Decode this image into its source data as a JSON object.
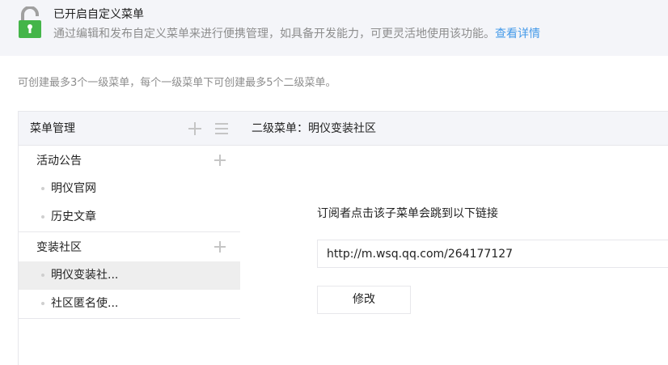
{
  "banner": {
    "icon": "lock-open-icon",
    "title": "已开启自定义菜单",
    "description": "通过编辑和发布自定义菜单来进行便携管理，如具备开发能力，可更灵活地使用该功能。",
    "link_text": "查看详情",
    "accent_color": "#44b549",
    "link_color": "#459ae9"
  },
  "hint": "可创建最多3个一级菜单，每个一级菜单下可创建最多5个二级菜单。",
  "menu": {
    "header": "菜单管理",
    "groups": [
      {
        "label": "活动公告",
        "items": [
          {
            "label": "明仪官网"
          },
          {
            "label": "历史文章"
          }
        ]
      },
      {
        "label": "变装社区",
        "items": [
          {
            "label": "明仪变装社...",
            "selected": true
          },
          {
            "label": "社区匿名使..."
          }
        ]
      }
    ]
  },
  "detail": {
    "title": "二级菜单：明仪变装社区",
    "description": "订阅者点击该子菜单会跳到以下链接",
    "url": "http://m.wsq.qq.com/264177127",
    "modify_label": "修改"
  }
}
